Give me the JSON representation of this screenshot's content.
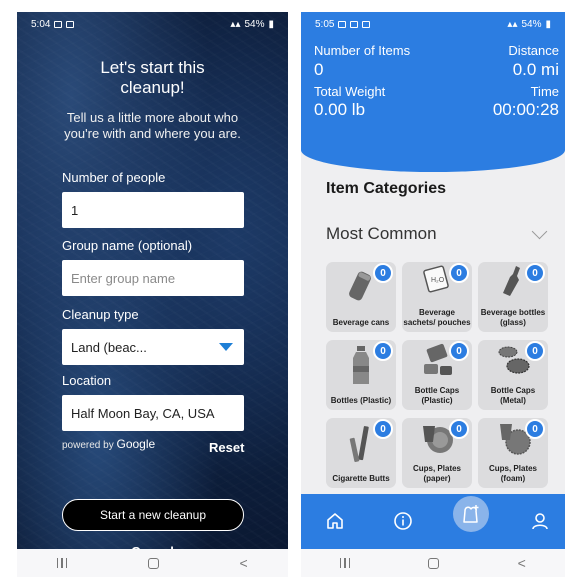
{
  "left": {
    "status": {
      "time": "5:04",
      "battery": "54%"
    },
    "title": "Let's start this cleanup!",
    "subtitle": "Tell us a little more about who you're with and where you are.",
    "people_label": "Number of people",
    "people_value": "1",
    "group_label": "Group name (optional)",
    "group_placeholder": "Enter group name",
    "type_label": "Cleanup type",
    "type_value": "Land (beac...",
    "location_label": "Location",
    "location_value": "Half Moon Bay, CA, USA",
    "powered_by": "powered by",
    "google": "Google",
    "reset": "Reset",
    "start_button": "Start a new cleanup",
    "cancel": "Cancel"
  },
  "right": {
    "status": {
      "time": "5:05",
      "battery": "54%"
    },
    "items_label": "Number of Items",
    "items_value": "0",
    "distance_label": "Distance",
    "distance_value": "0.0 mi",
    "weight_label": "Total Weight",
    "weight_value": "0.00 lb",
    "time_label": "Time",
    "time_value": "00:00:28",
    "categories_title": "Item Categories",
    "group_title": "Most Common",
    "tiles": [
      {
        "label": "Beverage cans",
        "count": "0",
        "icon": "can-icon"
      },
      {
        "label": "Beverage sachets/ pouches",
        "count": "0",
        "icon": "pouch-icon"
      },
      {
        "label": "Beverage bottles (glass)",
        "count": "0",
        "icon": "glass-bottle-icon"
      },
      {
        "label": "Bottles (Plastic)",
        "count": "0",
        "icon": "plastic-bottle-icon"
      },
      {
        "label": "Bottle Caps (Plastic)",
        "count": "0",
        "icon": "plastic-cap-icon"
      },
      {
        "label": "Bottle Caps (Metal)",
        "count": "0",
        "icon": "metal-cap-icon"
      },
      {
        "label": "Cigarette Butts",
        "count": "0",
        "icon": "cigarette-icon"
      },
      {
        "label": "Cups, Plates (paper)",
        "count": "0",
        "icon": "paper-cup-icon"
      },
      {
        "label": "Cups, Plates (foam)",
        "count": "0",
        "icon": "foam-cup-icon"
      }
    ],
    "colors": {
      "accent": "#2c7de1",
      "fab": "#8ab4ea",
      "tile": "#dcdcde"
    }
  }
}
